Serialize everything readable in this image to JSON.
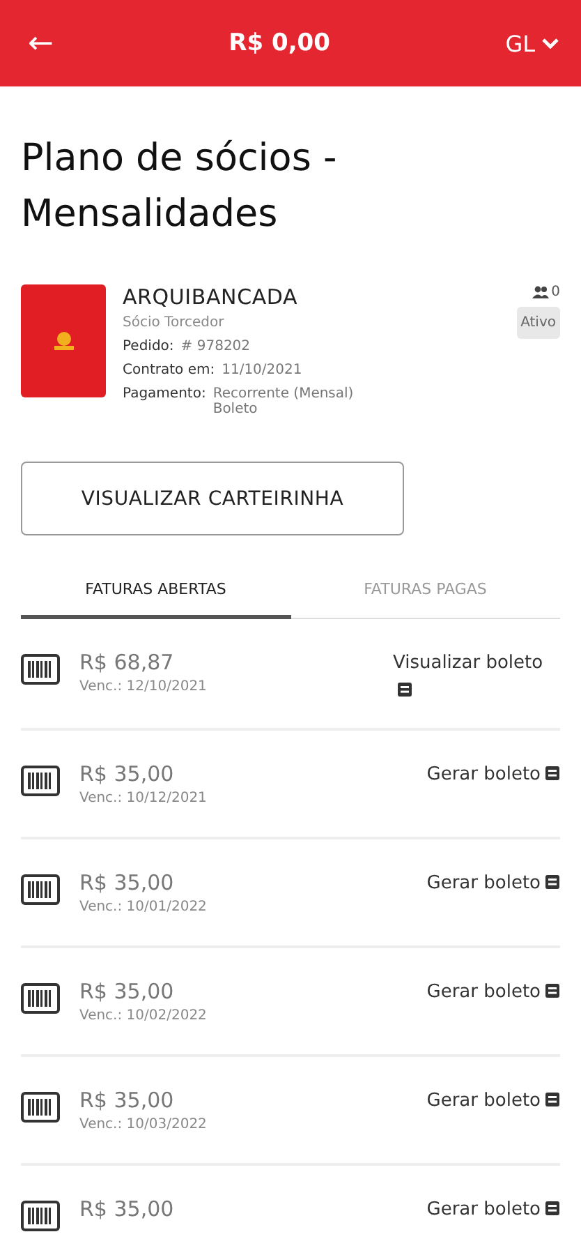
{
  "header": {
    "back": "←",
    "balance": "R$ 0,00",
    "user": "GL"
  },
  "title": "Plano de sócios - Mensalidades",
  "plan": {
    "name": "ARQUIBANCADA",
    "type": "Sócio Torcedor",
    "members": "0",
    "status": "Ativo",
    "details": [
      {
        "label": "Pedido:",
        "value": "# 978202"
      },
      {
        "label": "Contrato em:",
        "value": "11/10/2021"
      },
      {
        "label": "Pagamento:",
        "value": "Recorrente (Mensal)\nBoleto"
      }
    ]
  },
  "card_button": "VISUALIZAR CARTEIRINHA",
  "tabs": [
    {
      "label": "FATURAS ABERTAS",
      "selected": true
    },
    {
      "label": "FATURAS PAGAS",
      "selected": false
    }
  ],
  "invoices": [
    {
      "amount": "R$ 68,87",
      "due": "Venc.: 12/10/2021",
      "action": "Visualizar boleto"
    },
    {
      "amount": "R$ 35,00",
      "due": "Venc.: 10/12/2021",
      "action": "Gerar boleto"
    },
    {
      "amount": "R$ 35,00",
      "due": "Venc.: 10/01/2022",
      "action": "Gerar boleto"
    },
    {
      "amount": "R$ 35,00",
      "due": "Venc.: 10/02/2022",
      "action": "Gerar boleto"
    },
    {
      "amount": "R$ 35,00",
      "due": "Venc.: 10/03/2022",
      "action": "Gerar boleto"
    },
    {
      "amount": "R$ 35,00",
      "action": "Gerar boleto"
    }
  ]
}
